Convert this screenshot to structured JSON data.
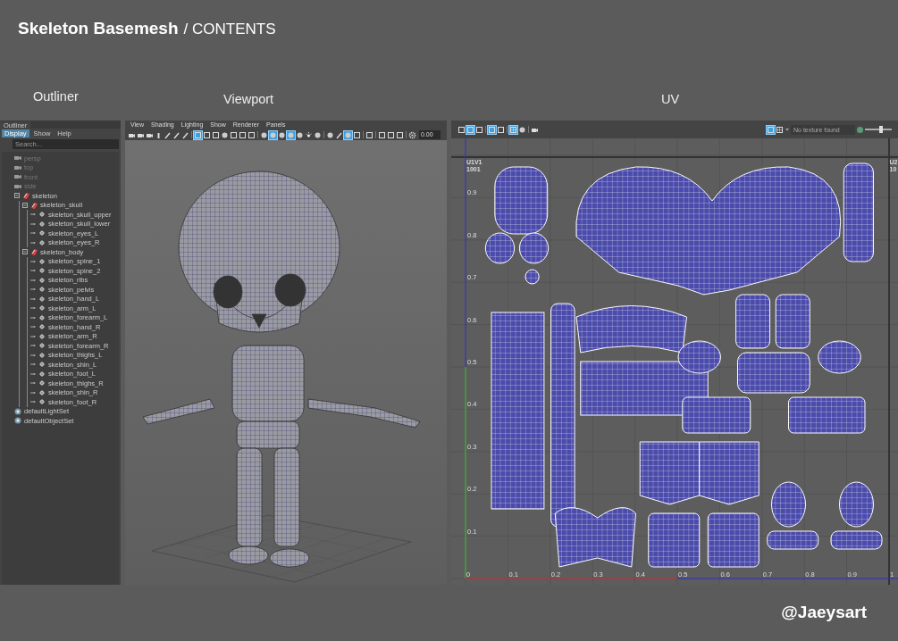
{
  "heading": {
    "title": "Skeleton Basemesh",
    "subtitle": "/ CONTENTS"
  },
  "section_labels": [
    "Outliner",
    "Viewport",
    "UV"
  ],
  "outliner": {
    "title": "Outliner",
    "menus": [
      {
        "label": "Display",
        "selected": true
      },
      {
        "label": "Show",
        "selected": false
      },
      {
        "label": "Help",
        "selected": false
      }
    ],
    "search": {
      "placeholder": "Search..."
    },
    "items": [
      {
        "label": "persp",
        "kind": "camera",
        "dimmed": true
      },
      {
        "label": "top",
        "kind": "camera",
        "dimmed": true
      },
      {
        "label": "front",
        "kind": "camera",
        "dimmed": true
      },
      {
        "label": "side",
        "kind": "camera",
        "dimmed": true
      },
      {
        "label": "skeleton",
        "kind": "group",
        "dimmed": false,
        "expanded": true,
        "children": [
          {
            "label": "skeleton_skull",
            "kind": "group",
            "dimmed": false,
            "expanded": true,
            "children": [
              {
                "label": "skeleton_skull_upper",
                "kind": "mesh",
                "dimmed": false
              },
              {
                "label": "skeleton_skull_lower",
                "kind": "mesh",
                "dimmed": false
              },
              {
                "label": "skeleton_eyes_L",
                "kind": "mesh",
                "dimmed": false
              },
              {
                "label": "skeleton_eyes_R",
                "kind": "mesh",
                "dimmed": false
              }
            ]
          },
          {
            "label": "skeleton_body",
            "kind": "group",
            "dimmed": false,
            "expanded": true,
            "children": [
              {
                "label": "skeleton_spine_1",
                "kind": "mesh",
                "dimmed": false
              },
              {
                "label": "skeleton_spine_2",
                "kind": "mesh",
                "dimmed": false
              },
              {
                "label": "skeleton_ribs",
                "kind": "mesh",
                "dimmed": false
              },
              {
                "label": "skeleton_pelvis",
                "kind": "mesh",
                "dimmed": false
              },
              {
                "label": "skeleton_hand_L",
                "kind": "mesh",
                "dimmed": false
              },
              {
                "label": "skeleton_arm_L",
                "kind": "mesh",
                "dimmed": false
              },
              {
                "label": "skeleton_forearm_L",
                "kind": "mesh",
                "dimmed": false
              },
              {
                "label": "skeleton_hand_R",
                "kind": "mesh",
                "dimmed": false
              },
              {
                "label": "skeleton_arm_R",
                "kind": "mesh",
                "dimmed": false
              },
              {
                "label": "skeleton_forearm_R",
                "kind": "mesh",
                "dimmed": false
              },
              {
                "label": "skeleton_thighs_L",
                "kind": "mesh",
                "dimmed": false
              },
              {
                "label": "skeleton_shin_L",
                "kind": "mesh",
                "dimmed": false
              },
              {
                "label": "skeleton_foot_L",
                "kind": "mesh",
                "dimmed": false
              },
              {
                "label": "skeleton_thighs_R",
                "kind": "mesh",
                "dimmed": false
              },
              {
                "label": "skeleton_shin_R",
                "kind": "mesh",
                "dimmed": false
              },
              {
                "label": "skeleton_foot_R",
                "kind": "mesh",
                "dimmed": false
              }
            ]
          }
        ]
      },
      {
        "label": "defaultLightSet",
        "kind": "set",
        "dimmed": false
      },
      {
        "label": "defaultObjectSet",
        "kind": "set",
        "dimmed": false
      }
    ]
  },
  "viewport": {
    "menus": [
      "View",
      "Shading",
      "Lighting",
      "Show",
      "Renderer",
      "Panels"
    ],
    "toolbar": [
      {
        "kind": "camera",
        "active": false
      },
      {
        "kind": "camera",
        "active": false
      },
      {
        "kind": "camera",
        "active": false
      },
      {
        "kind": "bar",
        "active": false
      },
      {
        "kind": "pen",
        "active": false
      },
      {
        "kind": "pen",
        "active": false
      },
      {
        "kind": "pen",
        "active": false
      },
      {
        "kind": "separator"
      },
      {
        "kind": "square",
        "active": true
      },
      {
        "kind": "square",
        "active": false
      },
      {
        "kind": "square",
        "active": false
      },
      {
        "kind": "sphere",
        "active": false
      },
      {
        "kind": "square",
        "active": false
      },
      {
        "kind": "square",
        "active": false
      },
      {
        "kind": "square",
        "active": false
      },
      {
        "kind": "separator"
      },
      {
        "kind": "sphere",
        "active": false
      },
      {
        "kind": "sphere",
        "active": true
      },
      {
        "kind": "sphere",
        "active": false
      },
      {
        "kind": "sphere",
        "active": true
      },
      {
        "kind": "sphere",
        "active": false
      },
      {
        "kind": "sun",
        "active": false
      },
      {
        "kind": "sphere",
        "active": false
      },
      {
        "kind": "separator"
      },
      {
        "kind": "sphere",
        "active": false
      },
      {
        "kind": "pen",
        "active": false
      },
      {
        "kind": "sphere",
        "active": true
      },
      {
        "kind": "square",
        "active": false
      },
      {
        "kind": "separator"
      },
      {
        "kind": "square",
        "active": false
      },
      {
        "kind": "separator"
      },
      {
        "kind": "square",
        "active": false
      },
      {
        "kind": "square",
        "active": false
      },
      {
        "kind": "square",
        "active": false
      },
      {
        "kind": "separator"
      },
      {
        "kind": "gear",
        "active": false
      }
    ],
    "value_field": "0.00"
  },
  "uv_editor": {
    "toolbar": [
      {
        "kind": "square",
        "active": false
      },
      {
        "kind": "square",
        "active": true
      },
      {
        "kind": "square",
        "active": false
      },
      {
        "kind": "separator"
      },
      {
        "kind": "square",
        "active": true
      },
      {
        "kind": "square",
        "active": false
      },
      {
        "kind": "separator"
      },
      {
        "kind": "grid",
        "active": true
      },
      {
        "kind": "sphere",
        "active": false
      },
      {
        "kind": "separator"
      },
      {
        "kind": "camera",
        "active": false
      }
    ],
    "right_toolbar": [
      {
        "kind": "square",
        "active": true
      },
      {
        "kind": "grid",
        "active": false
      }
    ],
    "texture_field": "No texture found",
    "exposure": {
      "level": 0.6
    },
    "tiles": [
      "U1V1\n1001",
      "U2\n10"
    ],
    "u_ticks": [
      "0",
      "0.1",
      "0.2",
      "0.3",
      "0.4",
      "0.5",
      "0.6",
      "0.7",
      "0.8",
      "0.9",
      "1"
    ],
    "v_ticks": [
      "0.9",
      "0.8",
      "0.7",
      "0.6",
      "0.5",
      "0.4",
      "0.3",
      "0.2",
      "0.1"
    ]
  },
  "credit": "@Jaeysart"
}
